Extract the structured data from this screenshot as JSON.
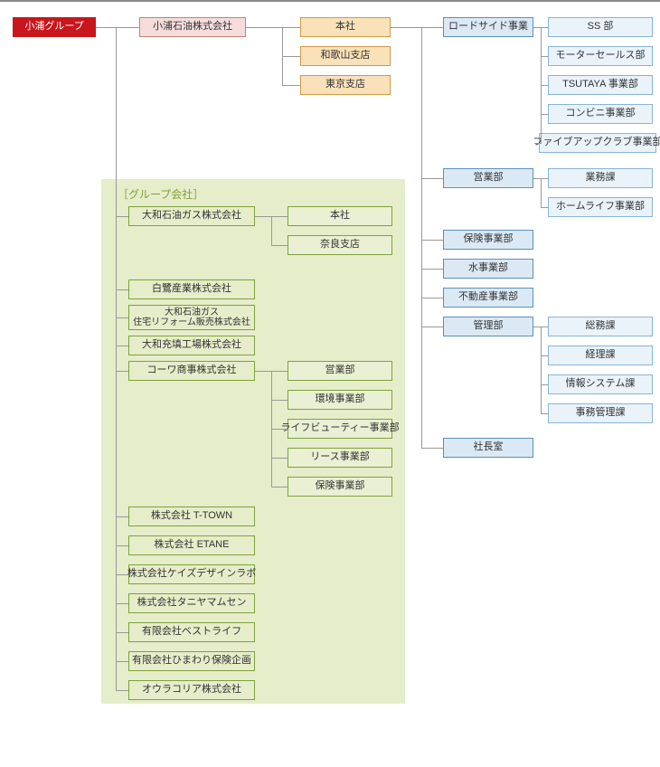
{
  "root": "小浦グループ",
  "company": "小浦石油株式会社",
  "offices": [
    "本社",
    "和歌山支店",
    "東京支店"
  ],
  "blue_divisions": [
    "ロードサイド事業",
    "営業部",
    "保険事業部",
    "水事業部",
    "不動産事業部",
    "管理部",
    "社長室"
  ],
  "roadside_children": [
    "SS 部",
    "モーターセールス部",
    "TSUTAYA 事業部",
    "コンビニ事業部",
    "ファイブアップクラブ事業部"
  ],
  "eigyo_children": [
    "業務課",
    "ホームライフ事業部"
  ],
  "kanri_children": [
    "総務課",
    "経理課",
    "情報システム課",
    "事務管理課"
  ],
  "group_panel_title": "［グループ会社］",
  "group_companies": [
    "大和石油ガス株式会社",
    "白鷺産業株式会社",
    "大和石油ガス\n住宅リフォーム販売株式会社",
    "大和充填工場株式会社",
    "コーワ商事株式会社",
    "株式会社 T-TOWN",
    "株式会社 ETANE",
    "株式会社ケイズデザインラボ",
    "株式会社タニヤマムセン",
    "有限会社ベストライフ",
    "有限会社ひまわり保険企画",
    "オウラコリア株式会社"
  ],
  "daiwa_children": [
    "本社",
    "奈良支店"
  ],
  "kowa_children": [
    "営業部",
    "環境事業部",
    "ライフビューティー事業部",
    "リース事業部",
    "保険事業部"
  ]
}
